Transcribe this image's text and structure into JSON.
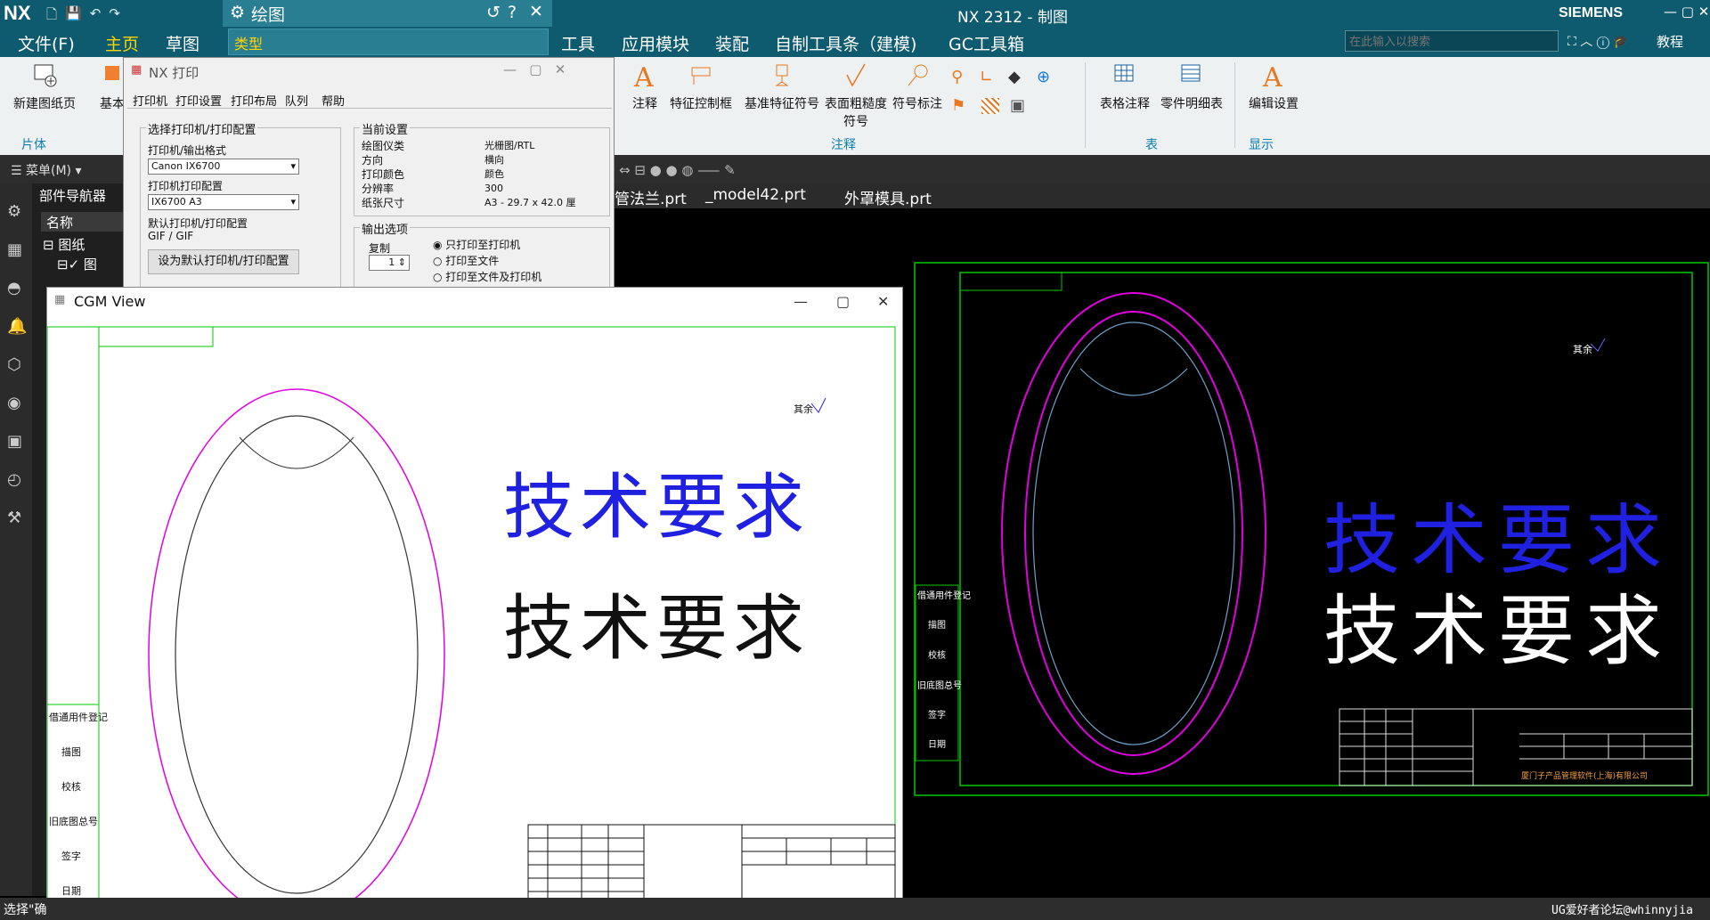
{
  "titlebar": {
    "logo": "NX",
    "title": "NX 2312 - 制图",
    "brand": "SIEMENS",
    "dialog_title": "绘图",
    "dialog_section": "类型"
  },
  "menu": {
    "items": [
      "文件(F)",
      "主页",
      "草图",
      "工具",
      "应用模块",
      "装配",
      "自制工具条（建模)",
      "GC工具箱"
    ],
    "search_placeholder": "在此输入以搜索",
    "tutorial": "教程"
  },
  "ribbon": {
    "new_sheet": "新建图纸页",
    "basic": "基本",
    "piece": "片体",
    "note": "注释",
    "feature_frame": "特征控制框",
    "datum_symbol": "基准特征符号",
    "surface_finish": "表面粗糙度符号",
    "symbol_label": "符号标注",
    "group_annotation": "注释",
    "table_note": "表格注释",
    "parts_list": "零件明细表",
    "group_table": "表",
    "edit_settings": "编辑设置",
    "group_display": "显示"
  },
  "cmdbar": {
    "menu": "菜单(M)"
  },
  "tabs": [
    "管法兰.prt",
    "_model42.prt",
    "外罩模具.prt"
  ],
  "nav": {
    "title": "部件导航器",
    "col_name": "名称",
    "item_sheets": "图纸",
    "item_sheet": "图"
  },
  "print_dialog": {
    "title": "NX 打印",
    "tabs": [
      "打印机",
      "打印设置",
      "打印布局",
      "队列",
      "帮助"
    ],
    "group_select": "选择打印机/打印配置",
    "printer_label": "打印机/输出格式",
    "printer_value": "Canon IX6700",
    "config_label": "打印机打印配置",
    "config_value": "IX6700 A3",
    "default_label": "默认打印机/打印配置",
    "default_value": "GIF / GIF",
    "set_default_button": "设为默认打印机/打印配置",
    "group_current": "当前设置",
    "cur_keys": [
      "绘图仪类",
      "方向",
      "打印颜色",
      "分辨率",
      "纸张尺寸"
    ],
    "cur_vals": [
      "光栅图/RTL",
      "横向",
      "颜色",
      "300",
      "A3 - 29.7 x 42.0 厘"
    ],
    "group_output": "输出选项",
    "copies_label": "复制",
    "copies_value": "1",
    "options": [
      "只打印至打印机",
      "打印至文件",
      "打印至文件及打印机"
    ]
  },
  "cgm": {
    "title": "CGM View",
    "tech_req": "技术要求",
    "rough": "其余"
  },
  "drawing": {
    "tech_req": "技术要求",
    "rough": "其余",
    "side_labels": [
      "借通用件登记",
      "描图",
      "校核",
      "旧底图总号",
      "签字",
      "日期"
    ],
    "company": "厦门子产品管理软件(上海)有限公司"
  },
  "status": {
    "left": "选择\"确",
    "right": "UG爱好者论坛@whinnyjia"
  },
  "colors": {
    "titlebar": "#0e5a6e",
    "accent": "#0e7dad",
    "frame": "#00c800",
    "ellipse": "#e000e0",
    "blue_text": "#2020e0"
  }
}
